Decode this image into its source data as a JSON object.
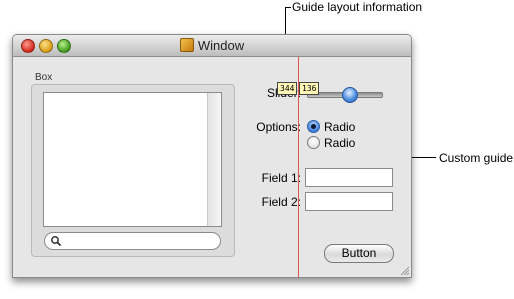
{
  "annotations": {
    "guide_layout_label": "Guide layout information",
    "custom_guide_label": "Custom guide"
  },
  "window": {
    "title": "Window",
    "box_title": "Box",
    "search_placeholder": "",
    "slider_label": "Slider:",
    "slider_value": 0.55,
    "options_label": "Options:",
    "radio_options": [
      "Radio",
      "Radio"
    ],
    "radio_selected_index": 0,
    "field1_label": "Field 1:",
    "field1_value": "",
    "field2_label": "Field 2:",
    "field2_value": "",
    "button_label": "Button",
    "guide_values": [
      "344",
      "136"
    ]
  },
  "colors": {
    "guide": "#e0524d",
    "badge": "#fff6b5"
  }
}
